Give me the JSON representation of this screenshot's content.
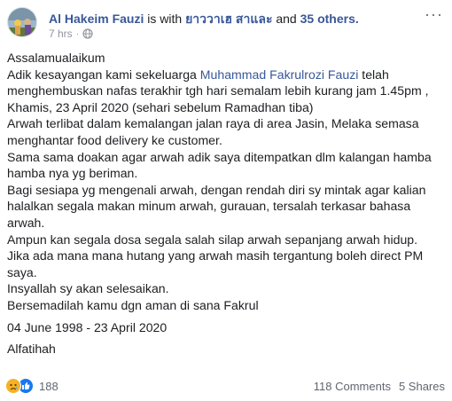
{
  "header": {
    "author": "Al Hakeim Fauzi",
    "with_text": "is with",
    "tagged": "ยาววาเฮ สาและ",
    "and_text": "and",
    "others": "35 others.",
    "time": "7 hrs",
    "dot": "·",
    "more": "···"
  },
  "post": {
    "lines": [
      "Assalamualaikum",
      "Adik kesayangan kami sekeluarga ",
      "Muhammad Fakrulrozi Fauzi",
      " telah",
      "menghembuskan nafas terakhir tgh hari semalam lebih kurang jam 1.45pm ,",
      "Khamis, 23 April 2020 (sehari sebelum Ramadhan tiba)",
      "Arwah terlibat dalam kemalangan jalan raya di area Jasin, Melaka semasa",
      "menghantar food delivery ke customer.",
      "Sama sama doakan agar arwah adik saya ditempatkan dlm kalangan hamba",
      "hamba nya yg beriman.",
      "Bagi sesiapa yg mengenali arwah, dengan rendah diri sy mintak agar kalian",
      "halalkan segala makan minum arwah, gurauan, tersalah terkasar bahasa",
      "arwah.",
      "Ampun kan segala dosa segala salah silap arwah sepanjang arwah hidup.",
      "Jika ada mana mana hutang yang arwah masih tergantung boleh direct PM",
      "saya.",
      "Insyallah sy akan selesaikan.",
      "Bersemadilah kamu dgn aman di sana Fakrul",
      "04 June 1998 - 23 April 2020",
      "Alfatihah"
    ]
  },
  "footer": {
    "reaction_count": "188",
    "comments": "118 Comments",
    "shares": "5 Shares"
  },
  "colors": {
    "link": "#385898",
    "meta": "#90949c",
    "sad": "#f7b125",
    "like": "#1877f2"
  }
}
